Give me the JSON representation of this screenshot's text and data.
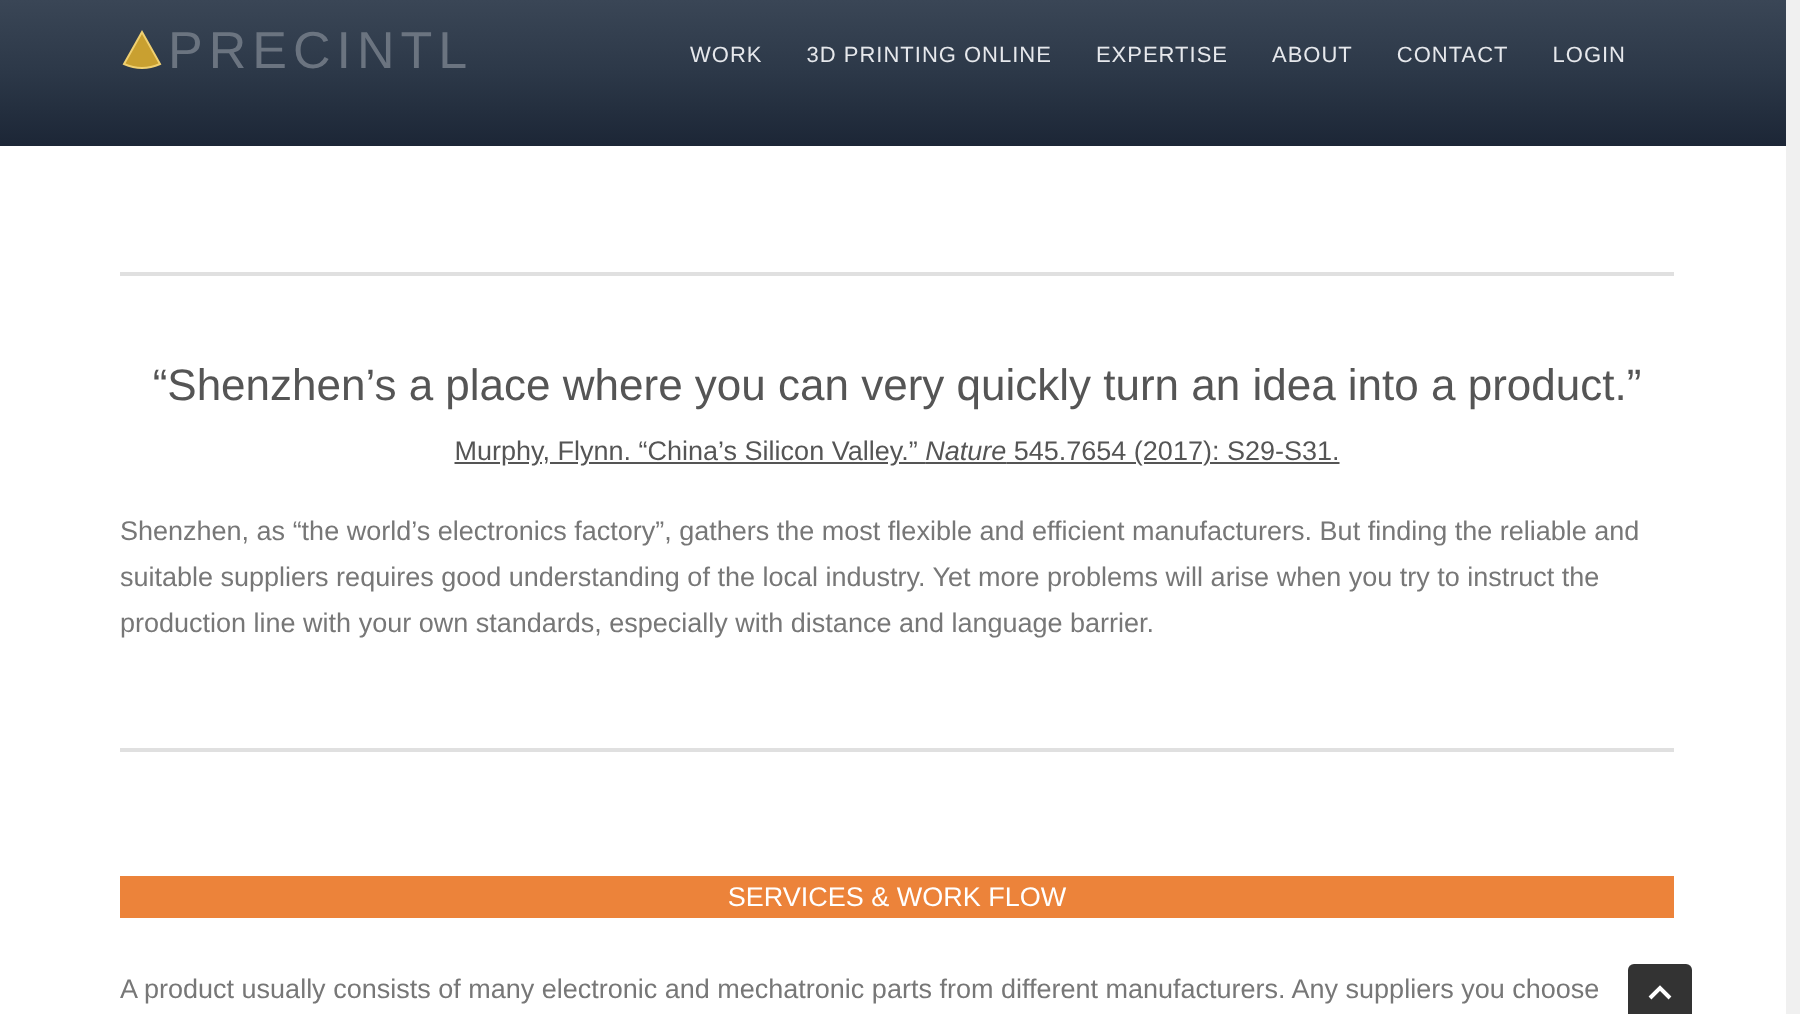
{
  "header": {
    "logo": "PRECINTL",
    "nav": [
      {
        "label": "WORK"
      },
      {
        "label": "3D PRINTING ONLINE"
      },
      {
        "label": "EXPERTISE"
      },
      {
        "label": "ABOUT"
      },
      {
        "label": "CONTACT"
      },
      {
        "label": "LOGIN"
      }
    ]
  },
  "quote": {
    "text": "“Shenzhen’s a place where you can very quickly turn an idea into a product.”",
    "citation": "Murphy, Flynn. “China’s Silicon Valley.” *Nature* 545.7654 (2017): S29-S31."
  },
  "intro": "Shenzhen, as “the world’s electronics factory”, gathers the most flexible and efficient manufacturers. But finding the reliable and suitable suppliers requires good understanding of the local industry. Yet more problems will arise when you try to instruct the production line with your own standards, especially with distance and language barrier.",
  "section_title": "SERVICES & WORK FLOW",
  "section_text": "A product usually consists of many electronic and mechatronic parts from different manufacturers. Any suppliers you choose"
}
